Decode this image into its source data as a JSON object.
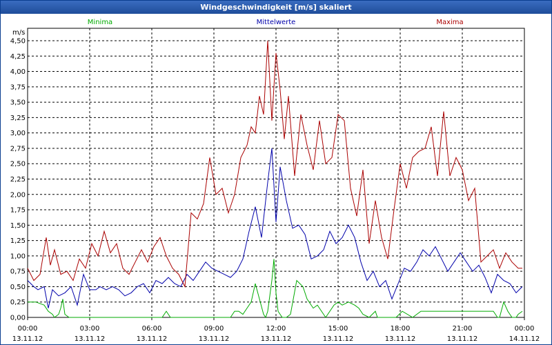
{
  "window": {
    "title": "Windgeschwindigkeit [m/s] skaliert"
  },
  "chart_data": {
    "type": "line",
    "title": "Windgeschwindigkeit [m/s] skaliert",
    "ylabel": "m/s",
    "ylim": [
      0,
      4.5
    ],
    "xlim": [
      0,
      24
    ],
    "grid": true,
    "legend_placement": "top",
    "y_ticks": [
      "0,00",
      "0,25",
      "0,50",
      "0,75",
      "1,00",
      "1,25",
      "1,50",
      "1,75",
      "2,00",
      "2,25",
      "2,50",
      "2,75",
      "3,00",
      "3,25",
      "3,50",
      "3,75",
      "4,00",
      "4,25",
      "4,50"
    ],
    "x_ticks": [
      {
        "time": "00:00",
        "date": "13.11.12"
      },
      {
        "time": "03:00",
        "date": "13.11.12"
      },
      {
        "time": "06:00",
        "date": "13.11.12"
      },
      {
        "time": "09:00",
        "date": "13.11.12"
      },
      {
        "time": "12:00",
        "date": "13.11.12"
      },
      {
        "time": "15:00",
        "date": "13.11.12"
      },
      {
        "time": "18:00",
        "date": "13.11.12"
      },
      {
        "time": "21:00",
        "date": "13.11.12"
      },
      {
        "time": "00:00",
        "date": "14.11.12"
      }
    ],
    "colors": {
      "Minima": "#00aa00",
      "Mittelwerte": "#0000aa",
      "Maxima": "#aa0000"
    },
    "series": [
      {
        "name": "Minima",
        "x": [
          0,
          0.4,
          0.8,
          1.0,
          1.2,
          1.3,
          1.5,
          1.6,
          1.7,
          1.8,
          2.0,
          2.2,
          6.0,
          6.5,
          6.7,
          6.9,
          9.8,
          10.0,
          10.2,
          10.4,
          10.6,
          10.8,
          11.0,
          11.2,
          11.4,
          11.5,
          11.6,
          11.8,
          11.9,
          12.0,
          12.1,
          12.3,
          12.5,
          12.7,
          13.0,
          13.3,
          13.5,
          13.8,
          14.0,
          14.2,
          14.4,
          14.6,
          14.8,
          15.0,
          15.2,
          15.5,
          15.8,
          16.0,
          16.2,
          16.5,
          16.8,
          16.9,
          17.2,
          17.5,
          17.8,
          18.1,
          18.6,
          19.0,
          20.0,
          21.0,
          22.0,
          22.3,
          22.5,
          22.6,
          22.7,
          22.8,
          23.0,
          23.2,
          23.4,
          23.6,
          23.7,
          23.9
        ],
        "values": [
          0.25,
          0.25,
          0.2,
          0.1,
          0.05,
          0.0,
          0.05,
          0.15,
          0.3,
          0.05,
          0.0,
          0.0,
          0.0,
          0.0,
          0.1,
          0.0,
          0.0,
          0.1,
          0.1,
          0.05,
          0.15,
          0.25,
          0.55,
          0.3,
          0.05,
          0.0,
          0.1,
          0.6,
          0.95,
          0.4,
          0.1,
          0.0,
          0.0,
          0.05,
          0.6,
          0.5,
          0.3,
          0.15,
          0.2,
          0.1,
          0.0,
          0.1,
          0.2,
          0.25,
          0.2,
          0.25,
          0.2,
          0.15,
          0.05,
          0.0,
          0.1,
          0.0,
          0.0,
          0.0,
          0.0,
          0.1,
          0.0,
          0.1,
          0.1,
          0.1,
          0.1,
          0.1,
          0.1,
          0.05,
          0.0,
          0.0,
          0.25,
          0.1,
          0.0,
          0.0,
          0.05,
          0.1
        ]
      },
      {
        "name": "Mittelwerte",
        "x": [
          0,
          0.3,
          0.5,
          0.8,
          1.0,
          1.2,
          1.5,
          1.8,
          2.1,
          2.4,
          2.7,
          3.0,
          3.3,
          3.5,
          3.8,
          4.1,
          4.4,
          4.7,
          5.0,
          5.3,
          5.6,
          5.9,
          6.2,
          6.5,
          6.8,
          7.1,
          7.4,
          7.7,
          8.0,
          8.3,
          8.6,
          8.9,
          9.2,
          9.5,
          9.8,
          10.1,
          10.4,
          10.7,
          11.0,
          11.3,
          11.6,
          11.8,
          12.0,
          12.2,
          12.5,
          12.8,
          13.1,
          13.4,
          13.7,
          14.0,
          14.3,
          14.6,
          14.9,
          15.2,
          15.5,
          15.8,
          16.1,
          16.4,
          16.7,
          17.0,
          17.3,
          17.6,
          17.9,
          18.2,
          18.5,
          18.8,
          19.1,
          19.4,
          19.7,
          20.0,
          20.3,
          20.6,
          20.9,
          21.2,
          21.5,
          21.8,
          22.1,
          22.4,
          22.7,
          23.0,
          23.3,
          23.6,
          23.9
        ],
        "values": [
          0.6,
          0.5,
          0.45,
          0.5,
          0.15,
          0.45,
          0.35,
          0.4,
          0.5,
          0.2,
          0.7,
          0.45,
          0.45,
          0.5,
          0.45,
          0.5,
          0.45,
          0.35,
          0.4,
          0.5,
          0.55,
          0.4,
          0.6,
          0.55,
          0.65,
          0.55,
          0.5,
          0.7,
          0.6,
          0.75,
          0.9,
          0.8,
          0.75,
          0.7,
          0.65,
          0.75,
          0.95,
          1.4,
          1.8,
          1.3,
          2.2,
          2.75,
          1.55,
          2.45,
          1.9,
          1.45,
          1.5,
          1.35,
          0.95,
          1.0,
          1.1,
          1.4,
          1.2,
          1.3,
          1.5,
          1.3,
          0.9,
          0.6,
          0.75,
          0.5,
          0.6,
          0.3,
          0.55,
          0.8,
          0.75,
          0.9,
          1.1,
          1.0,
          1.15,
          0.95,
          0.75,
          0.9,
          1.05,
          0.9,
          0.75,
          0.85,
          0.65,
          0.4,
          0.7,
          0.6,
          0.55,
          0.4,
          0.5
        ]
      },
      {
        "name": "Maxima",
        "x": [
          0,
          0.3,
          0.6,
          0.9,
          1.1,
          1.3,
          1.6,
          1.9,
          2.2,
          2.5,
          2.8,
          3.1,
          3.4,
          3.7,
          4.0,
          4.3,
          4.6,
          4.9,
          5.2,
          5.5,
          5.8,
          6.1,
          6.4,
          6.7,
          7.0,
          7.3,
          7.6,
          7.9,
          8.2,
          8.5,
          8.8,
          9.1,
          9.4,
          9.7,
          10.0,
          10.3,
          10.6,
          10.8,
          11.0,
          11.2,
          11.4,
          11.6,
          11.8,
          12.0,
          12.2,
          12.4,
          12.6,
          12.9,
          13.2,
          13.5,
          13.8,
          14.1,
          14.4,
          14.7,
          15.0,
          15.3,
          15.6,
          15.9,
          16.2,
          16.5,
          16.8,
          17.1,
          17.4,
          17.7,
          18.0,
          18.3,
          18.6,
          18.9,
          19.2,
          19.5,
          19.8,
          20.1,
          20.4,
          20.7,
          21.0,
          21.3,
          21.6,
          21.9,
          22.2,
          22.5,
          22.8,
          23.1,
          23.4,
          23.7,
          23.9
        ],
        "values": [
          0.8,
          0.6,
          0.7,
          1.3,
          0.85,
          1.1,
          0.7,
          0.75,
          0.6,
          0.95,
          0.8,
          1.2,
          1.0,
          1.4,
          1.05,
          1.2,
          0.8,
          0.7,
          0.9,
          1.1,
          0.9,
          1.15,
          1.3,
          1.0,
          0.8,
          0.7,
          0.5,
          1.7,
          1.6,
          1.85,
          2.6,
          2.0,
          2.1,
          1.7,
          2.0,
          2.6,
          2.8,
          3.1,
          3.0,
          3.6,
          3.3,
          4.5,
          3.2,
          4.3,
          3.7,
          2.9,
          3.6,
          2.3,
          3.3,
          2.8,
          2.4,
          3.2,
          2.5,
          2.6,
          3.3,
          3.2,
          2.1,
          1.65,
          2.4,
          1.2,
          1.9,
          1.3,
          0.95,
          1.75,
          2.5,
          2.1,
          2.6,
          2.7,
          2.75,
          3.1,
          2.3,
          3.35,
          2.3,
          2.6,
          2.4,
          1.9,
          2.1,
          0.9,
          1.0,
          1.1,
          0.8,
          1.05,
          0.9,
          0.8,
          0.8
        ]
      }
    ]
  }
}
